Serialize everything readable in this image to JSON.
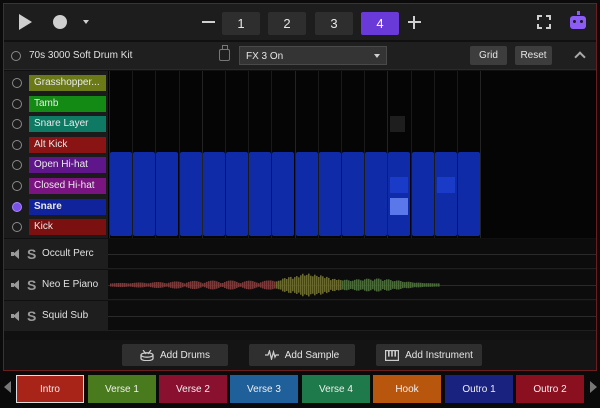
{
  "toolbar": {
    "patterns": [
      "1",
      "2",
      "3",
      "4"
    ],
    "active_pattern": "4"
  },
  "instrument_header": {
    "kit_name": "70s 3000 Soft Drum Kit",
    "fx_value": "FX 3 On",
    "grid_label": "Grid",
    "reset_label": "Reset"
  },
  "drums": [
    {
      "label": "Grasshopper...",
      "color": "#6b7a16"
    },
    {
      "label": "Tamb",
      "color": "#128a14"
    },
    {
      "label": "Snare Layer",
      "color": "#0f7a63"
    },
    {
      "label": "Alt Kick",
      "color": "#8a1414"
    },
    {
      "label": "Open Hi-hat",
      "color": "#5e168a"
    },
    {
      "label": "Closed Hi-hat",
      "color": "#7a1480"
    },
    {
      "label": "Snare",
      "color": "#11239a",
      "selected": true
    },
    {
      "label": "Kick",
      "color": "#7a1010"
    }
  ],
  "instruments": [
    {
      "name": "Occult Perc"
    },
    {
      "name": "Neo E Piano"
    },
    {
      "name": "Squid Sub"
    }
  ],
  "add_bar": {
    "add_drums": "Add Drums",
    "add_sample": "Add Sample",
    "add_instrument": "Add Instrument"
  },
  "sections": [
    {
      "label": "Intro",
      "color": "#a82418",
      "active": true
    },
    {
      "label": "Verse 1",
      "color": "#4a7a1e"
    },
    {
      "label": "Verse 2",
      "color": "#8a1030"
    },
    {
      "label": "Verse 3",
      "color": "#1f5f9a"
    },
    {
      "label": "Verse 4",
      "color": "#1e7a4a"
    },
    {
      "label": "Hook",
      "color": "#b8560e"
    },
    {
      "label": "Outro 1",
      "color": "#1a2280"
    },
    {
      "label": "Outro 2",
      "color": "#8a1020"
    }
  ]
}
